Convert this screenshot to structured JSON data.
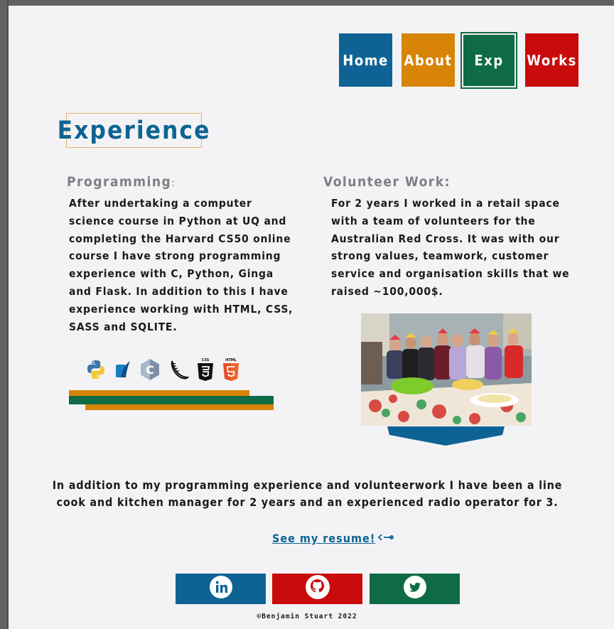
{
  "nav": {
    "home": "Home",
    "about": "About",
    "exp": "Exp",
    "works": "Works"
  },
  "page": {
    "title": "Experience"
  },
  "programming": {
    "heading": "Programming",
    "colon": ":",
    "text": "After undertaking a computer science course in Python at UQ and completing the Harvard CS50 online course I have strong programming experience with C, Python, Ginga and Flask. In addition to this I have experience working with HTML, CSS, SASS and SQLITE.",
    "icons": [
      "python-icon",
      "sqlite-icon",
      "c-language-icon",
      "flask-icon",
      "css3-icon",
      "html5-icon"
    ],
    "icon_labels": {
      "css": "CSS",
      "html": "HTML"
    }
  },
  "volunteer": {
    "heading": "Volunteer Work:",
    "text": "For 2 years I worked in a retail space with a team of volunteers for the Australian Red Cross. It was with our strong values, teamwork, customer service and organisation skills that we raised ~100,000$."
  },
  "summary": {
    "text": "In addition to my programming experience and volunteerwork I have been a line cook and kitchen manager for 2 years and an experienced radio operator for 3."
  },
  "resume": {
    "link_text": "See my resume!",
    "icon": "arrow-link-icon"
  },
  "social": {
    "linkedin": "linkedin-icon",
    "github": "github-icon",
    "twitter": "twitter-icon"
  },
  "footer": {
    "copyright": "©Benjamin Stuart 2022"
  },
  "colors": {
    "blue": "#0f6394",
    "orange": "#d88406",
    "green": "#0e6b46",
    "red": "#c90b0b",
    "heading_gray": "#7d7f83",
    "background": "#f3f3f5"
  }
}
